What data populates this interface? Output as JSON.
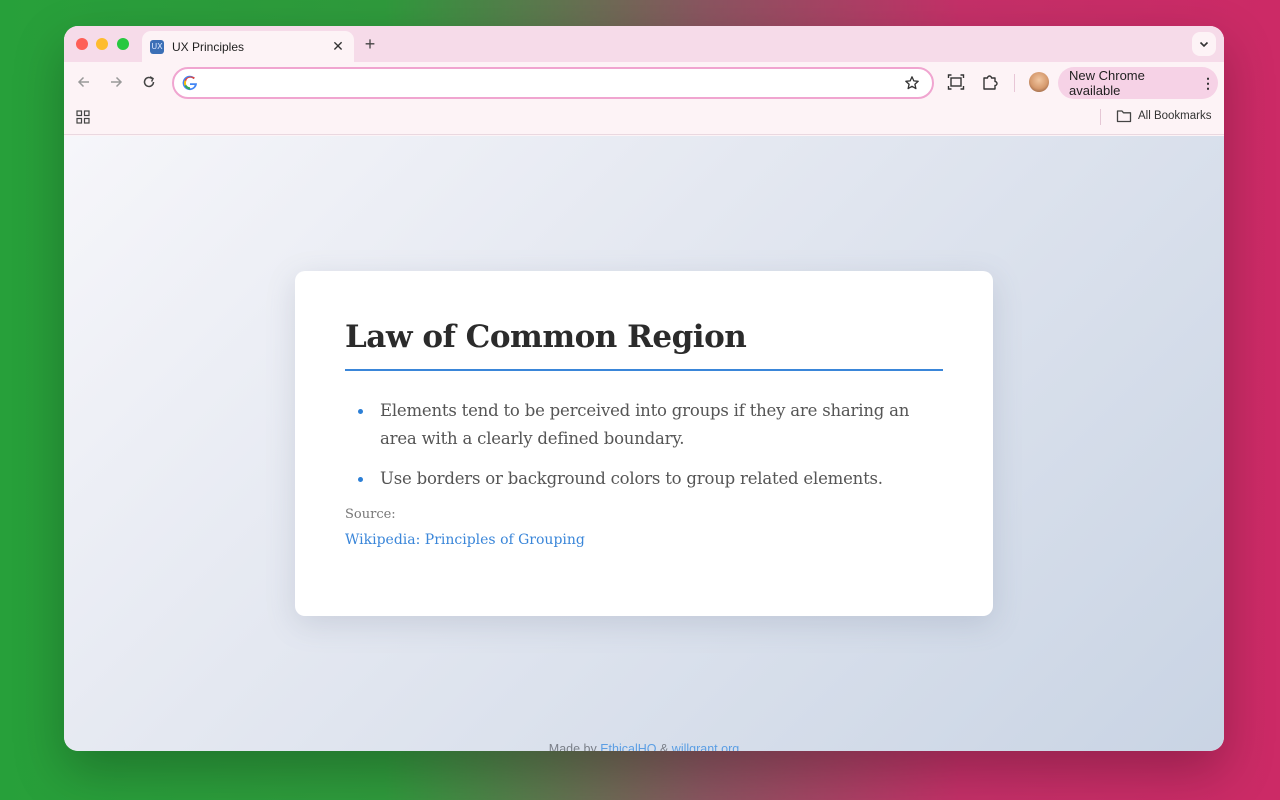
{
  "browser": {
    "tab": {
      "favicon_text": "UX",
      "title": "UX Principles"
    },
    "new_tab_symbol": "+",
    "update_chip_label": "New Chrome available",
    "bookmarks": {
      "all_label": "All Bookmarks"
    },
    "colors": {
      "tabstrip": "#f6dbe9",
      "omnibox_border": "#f0a5d0",
      "chip": "#f6d2e6"
    }
  },
  "page": {
    "title": "Law of Common Region",
    "bullets": [
      "Elements tend to be perceived into groups if they are sharing an area with a clearly defined boundary.",
      "Use borders or background colors to group related elements."
    ],
    "source_label": "Source:",
    "source_link": "Wikipedia: Principles of Grouping",
    "footer": {
      "prefix": "Made by ",
      "link1": "EthicalHQ",
      "sep": " & ",
      "link2": "willgrant.org"
    },
    "colors": {
      "accent": "#3a86d9",
      "bullet": "#2c7fd6"
    }
  }
}
